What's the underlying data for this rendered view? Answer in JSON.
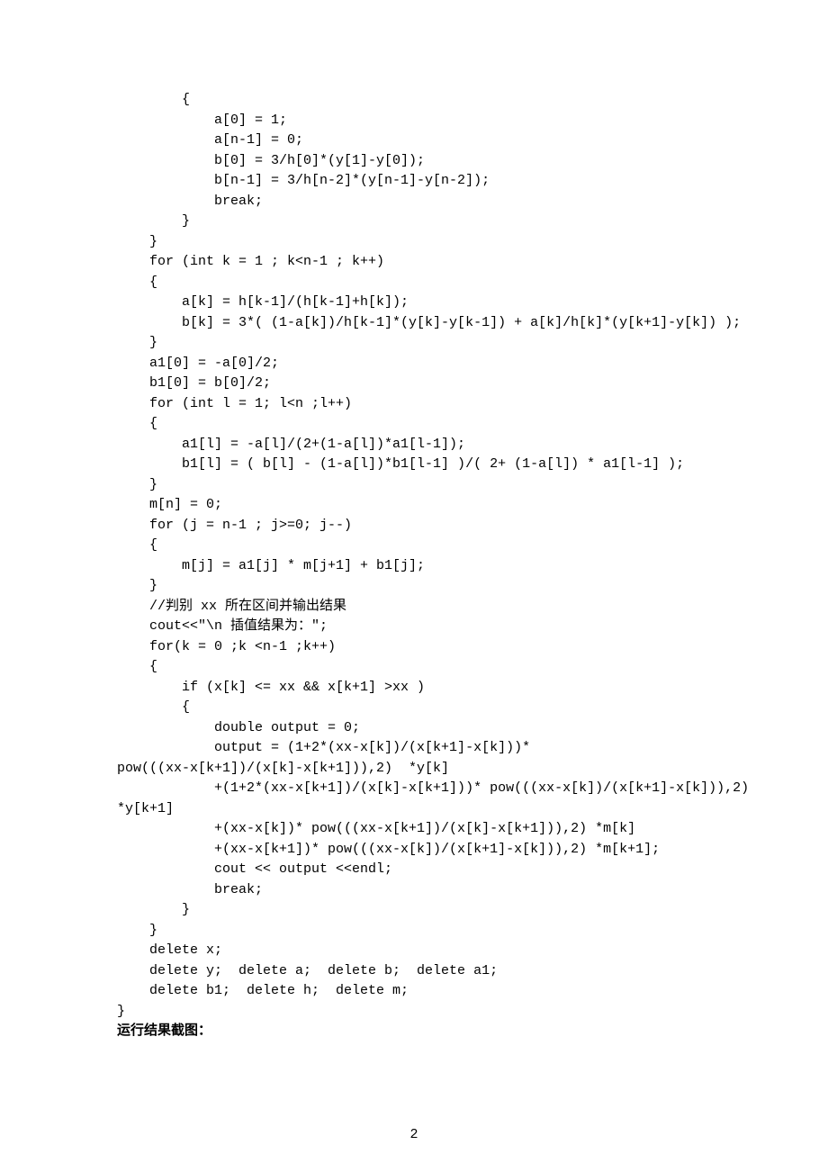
{
  "code": {
    "block1": "        {\n            a[0] = 1;\n            a[n-1] = 0;\n            b[0] = 3/h[0]*(y[1]-y[0]);\n            b[n-1] = 3/h[n-2]*(y[n-1]-y[n-2]);\n            break;\n        }\n    }\n    for (int k = 1 ; k<n-1 ; k++)\n    {\n        a[k] = h[k-1]/(h[k-1]+h[k]);\n        b[k] = 3*( (1-a[k])/h[k-1]*(y[k]-y[k-1]) + a[k]/h[k]*(y[k+1]-y[k]) );\n    }\n    a1[0] = -a[0]/2;\n    b1[0] = b[0]/2;\n    for (int l = 1; l<n ;l++)\n    {\n        a1[l] = -a[l]/(2+(1-a[l])*a1[l-1]);\n        b1[l] = ( b[l] - (1-a[l])*b1[l-1] )/( 2+ (1-a[l]) * a1[l-1] );\n    }\n    m[n] = 0;\n    for (j = n-1 ; j>=0; j--)\n    {\n        m[j] = a1[j] * m[j+1] + b1[j];\n    }\n    //判别 xx 所在区间并输出结果\n    cout<<\"\\n 插值结果为：\";\n    for(k = 0 ;k <n-1 ;k++)\n    {\n        if (x[k] <= xx && x[k+1] >xx )\n        {\n            double output = 0;\n            output = (1+2*(xx-x[k])/(x[k+1]-x[k]))*",
    "block2_noindent": "pow(((xx-x[k+1])/(x[k]-x[k+1])),2)  *y[k]",
    "block3": "            +(1+2*(xx-x[k+1])/(x[k]-x[k+1]))* pow(((xx-x[k])/(x[k+1]-x[k])),2)",
    "block4_noindent": "*y[k+1]",
    "block5": "            +(xx-x[k])* pow(((xx-x[k+1])/(x[k]-x[k+1])),2) *m[k]\n            +(xx-x[k+1])* pow(((xx-x[k])/(x[k+1]-x[k])),2) *m[k+1];\n            cout << output <<endl;\n            break;\n        }\n    }\n    delete x;\n    delete y;  delete a;  delete b;  delete a1;\n    delete b1;  delete h;  delete m;\n}"
  },
  "heading": "运行结果截图：",
  "page_number": "2"
}
